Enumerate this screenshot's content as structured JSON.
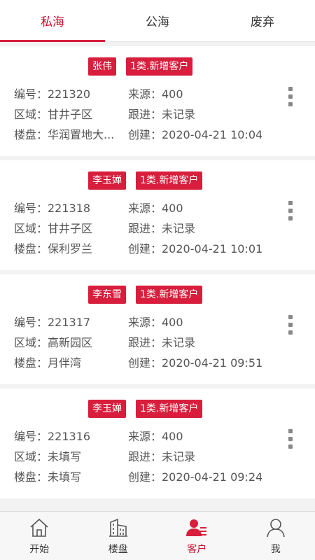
{
  "tabs": [
    {
      "label": "私海",
      "active": true
    },
    {
      "label": "公海",
      "active": false
    },
    {
      "label": "废弃",
      "active": false
    }
  ],
  "customers": [
    {
      "name": "张伟",
      "type": "1类.新增客户",
      "id": "编号：221320",
      "source": "来源：400",
      "area": "区域：甘井子区",
      "followup": "跟进：未记录",
      "property": "楼盘：华润置地大...",
      "created": "创建：2020-04-21 10:04"
    },
    {
      "name": "李玉婵",
      "type": "1类.新增客户",
      "id": "编号：221318",
      "source": "来源：400",
      "area": "区域：甘井子区",
      "followup": "跟进：未记录",
      "property": "楼盘：保利罗兰",
      "created": "创建：2020-04-21 10:01"
    },
    {
      "name": "李东雪",
      "type": "1类.新增客户",
      "id": "编号：221317",
      "source": "来源：400",
      "area": "区域：高新园区",
      "followup": "跟进：未记录",
      "property": "楼盘：月伴湾",
      "created": "创建：2020-04-21 09:51"
    },
    {
      "name": "李玉婵",
      "type": "1类.新增客户",
      "id": "编号：221316",
      "source": "来源：400",
      "area": "区域：未填写",
      "followup": "跟进：未记录",
      "property": "楼盘：未填写",
      "created": "创建：2020-04-21 09:24"
    }
  ],
  "nav": [
    {
      "label": "开始",
      "icon": "home-icon",
      "active": false
    },
    {
      "label": "楼盘",
      "icon": "building-icon",
      "active": false
    },
    {
      "label": "客户",
      "icon": "customer-icon",
      "active": true
    },
    {
      "label": "我",
      "icon": "user-icon",
      "active": false
    }
  ],
  "colors": {
    "accent": "#d81e3c",
    "accent_text": "#c8102e"
  }
}
